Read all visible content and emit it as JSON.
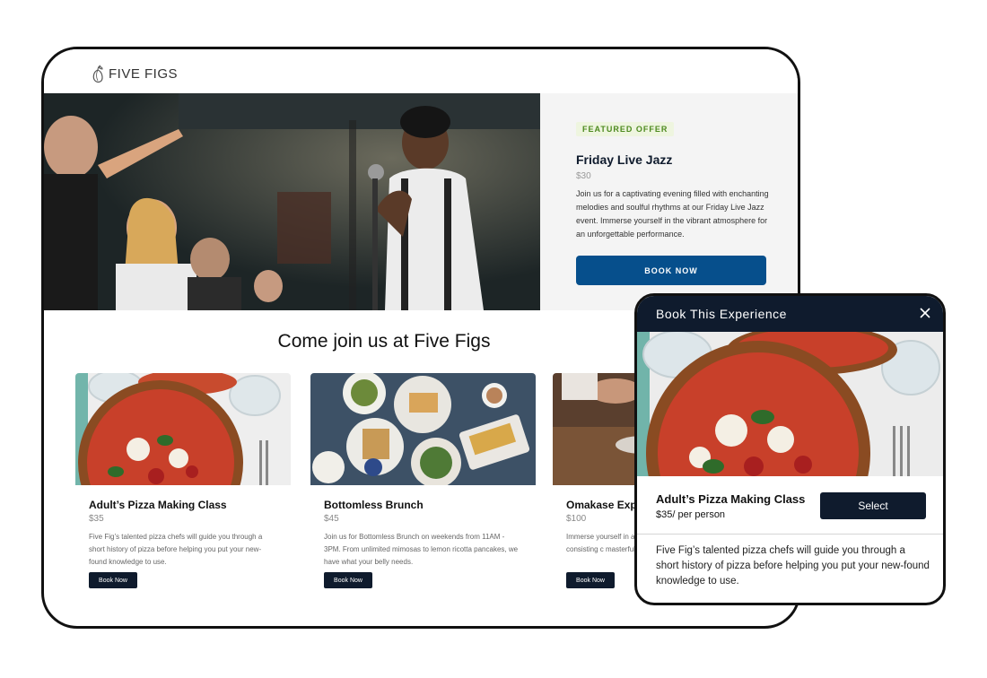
{
  "brand": {
    "name": "FIVE FIGS"
  },
  "hero": {
    "badge": "FEATURED OFFER",
    "title": "Friday Live Jazz",
    "price": "$30",
    "description": "Join us for a captivating evening filled with enchanting melodies and soulful rhythms at our Friday Live Jazz event. Immerse yourself in the vibrant atmosphere for an unforgettable performance.",
    "button_label": "BOOK NOW",
    "image_icon": "live-jazz-photo"
  },
  "section": {
    "title": "Come join us at Five Figs"
  },
  "cards": [
    {
      "title": "Adult’s Pizza Making Class",
      "price": "$35",
      "description": "Five Fig’s talented pizza chefs will guide you through a short history of pizza before helping you put your new-found knowledge to use.",
      "button_label": "Book Now",
      "image_icon": "pizza-photo"
    },
    {
      "title": "Bottomless Brunch",
      "price": "$45",
      "description": "Join us for Bottomless Brunch on weekends from 11AM - 3PM. From unlimited mimosas to lemon ricotta pancakes, we have what your belly needs.",
      "button_label": "Book Now",
      "image_icon": "brunch-photo"
    },
    {
      "title": "Omakase Experi",
      "price": "$100",
      "description": "Immerse yourself in a r experience consisting c masterful chefs – Chef",
      "button_label": "Book Now",
      "image_icon": "chef-photo"
    }
  ],
  "modal": {
    "title": "Book This Experience",
    "item_title": "Adult’s Pizza Making Class",
    "item_price": "$35/ per person",
    "button_label": "Select",
    "description": "Five Fig’s talented pizza chefs will guide you through a short history of pizza before helping you put your new-found knowledge to use.",
    "close_icon": "close-icon",
    "image_icon": "pizza-photo"
  },
  "colors": {
    "navy": "#0f1b2d",
    "accent_blue": "#064f8c",
    "badge_green": "#4d8a1f",
    "badge_bg": "#eef5df"
  }
}
